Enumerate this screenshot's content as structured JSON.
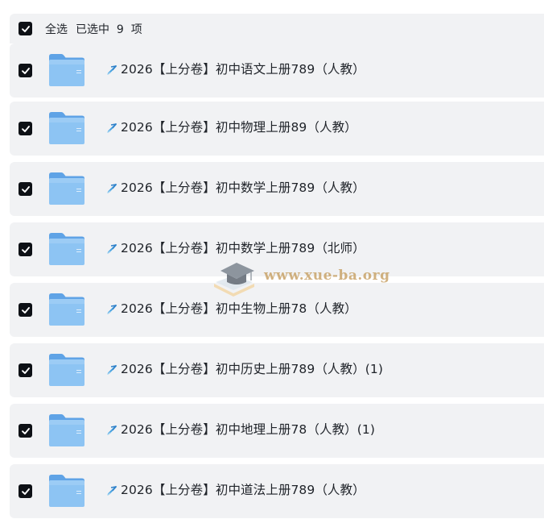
{
  "header": {
    "select_all_label": "全选",
    "selected_count_label": "已选中  9  项"
  },
  "files": [
    {
      "name": "2026【上分卷】初中语文上册789（人教）",
      "checked": true
    },
    {
      "name": "2026【上分卷】初中物理上册89（人教）",
      "checked": true
    },
    {
      "name": "2026【上分卷】初中数学上册789（人教）",
      "checked": true
    },
    {
      "name": "2026【上分卷】初中数学上册789（北师）",
      "checked": true
    },
    {
      "name": "2026【上分卷】初中生物上册78（人教）",
      "checked": true
    },
    {
      "name": "2026【上分卷】初中历史上册789（人教）(1)",
      "checked": true
    },
    {
      "name": "2026【上分卷】初中地理上册78（人教）(1)",
      "checked": true
    },
    {
      "name": "2026【上分卷】初中道法上册789（人教）",
      "checked": true
    }
  ],
  "watermark": {
    "text": "www.xue-ba.org"
  },
  "colors": {
    "row_bg": "#f1f2f4",
    "checkbox": "#0e1116",
    "folder_blue": "#7db7ee",
    "watermark_gold": "#c9a46a"
  }
}
